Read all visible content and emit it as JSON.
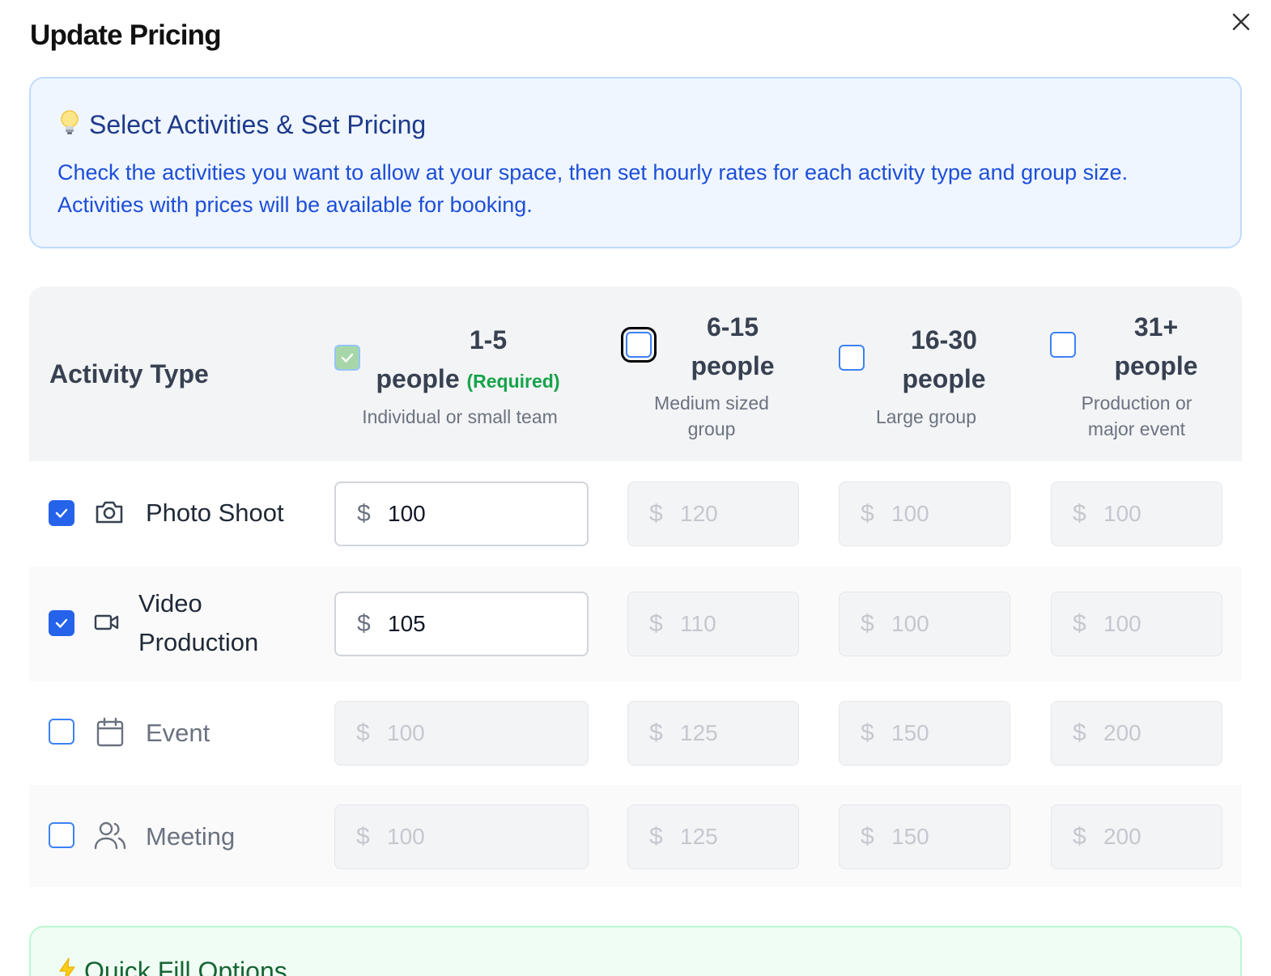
{
  "dialog": {
    "title": "Update Pricing"
  },
  "info": {
    "title": "Select Activities & Set Pricing",
    "text": "Check the activities you want to allow at your space, then set hourly rates for each activity type and group size. Activities with prices will be available for booking."
  },
  "table": {
    "activity_header": "Activity Type",
    "columns": [
      {
        "line1": "1-5",
        "line2": "people",
        "required": "(Required)",
        "sub": "Individual or small team",
        "checked": true
      },
      {
        "line1": "6-15",
        "line2": "people",
        "sub": "Medium sized group",
        "checked": false
      },
      {
        "line1": "16-30",
        "line2": "people",
        "sub": "Large group",
        "checked": false
      },
      {
        "line1": "31+",
        "line2": "people",
        "sub": "Production or major event",
        "checked": false
      }
    ],
    "rows": [
      {
        "label": "Photo Shoot",
        "icon": "camera-icon",
        "checked": true,
        "prices": [
          "100",
          "120",
          "100",
          "100"
        ]
      },
      {
        "label": "Video Production",
        "icon": "video-icon",
        "checked": true,
        "prices": [
          "105",
          "110",
          "100",
          "100"
        ]
      },
      {
        "label": "Event",
        "icon": "calendar-icon",
        "checked": false,
        "prices": [
          "100",
          "125",
          "150",
          "200"
        ]
      },
      {
        "label": "Meeting",
        "icon": "users-icon",
        "checked": false,
        "prices": [
          "100",
          "125",
          "150",
          "200"
        ]
      }
    ],
    "currency": "$"
  },
  "quick_fill": {
    "title": "Quick Fill Options"
  },
  "colors": {
    "accent": "#2563eb",
    "info_bg": "#eff6ff",
    "success": "#16a34a"
  }
}
